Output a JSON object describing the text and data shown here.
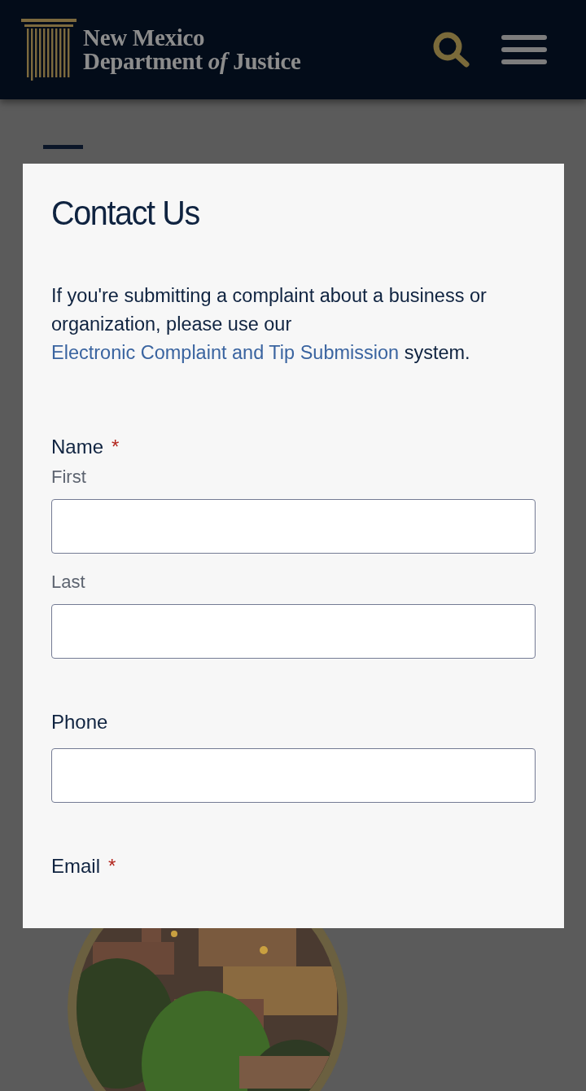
{
  "header": {
    "logo_lines": [
      "New Mexico",
      "Department *of* Justice"
    ]
  },
  "modal": {
    "title": "Contact Us",
    "intro": {
      "before": "If you're submitting a complaint about a business or organization, please use our ",
      "link": "Electronic Complaint and Tip Submission",
      "after": " system."
    },
    "fields": [
      {
        "label": "Name",
        "marker": "*",
        "inputs": [
          {
            "kind": "text",
            "sublabel": "First"
          },
          {
            "kind": "text",
            "sublabel": "Last"
          }
        ]
      },
      {
        "label": "Phone",
        "inputs": [
          {
            "kind": "text"
          }
        ]
      },
      {
        "label": "Email",
        "marker": "*"
      }
    ]
  }
}
